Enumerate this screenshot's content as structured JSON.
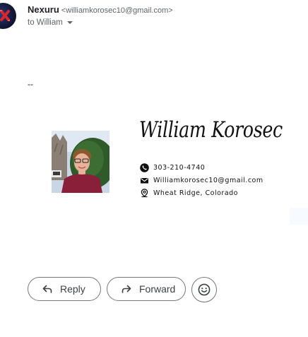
{
  "message": {
    "sender_name": "Nexuru",
    "sender_email": "<williamkorosec10@gmail.com>",
    "recipient_label": "to William"
  },
  "signature": {
    "separator": "--",
    "script_name": "William Korosec",
    "phone": "303-210-4740",
    "email": "Williamkorosec10@gmail.com",
    "location": "Wheat Ridge, Colorado"
  },
  "actions": {
    "reply_label": "Reply",
    "forward_label": "Forward"
  },
  "icons": {
    "phone": "phone-icon",
    "email": "envelope-icon",
    "location": "map-pin-icon",
    "reply": "reply-arrow-icon",
    "forward": "forward-arrow-icon",
    "emoji": "emoji-smile-icon",
    "recipient_toggle": "caret-down-icon"
  },
  "colors": {
    "sender_name": "#202124",
    "secondary_text": "#5f6368",
    "button_border": "#747775",
    "button_text": "#3c4043"
  }
}
